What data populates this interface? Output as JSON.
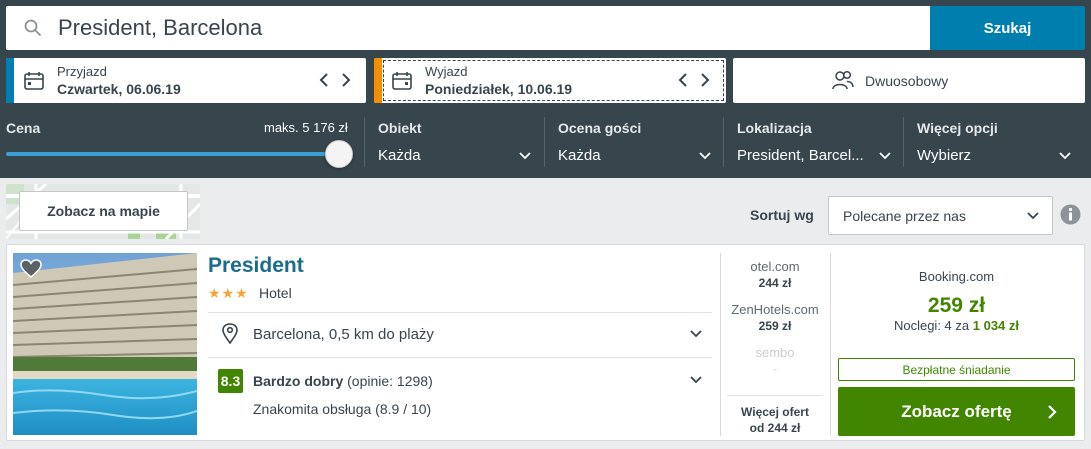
{
  "search": {
    "query": "President, Barcelona",
    "button_label": "Szukaj"
  },
  "dates": {
    "checkin_label": "Przyjazd",
    "checkin_value": "Czwartek, 06.06.19",
    "checkout_label": "Wyjazd",
    "checkout_value": "Poniedziałek, 10.06.19"
  },
  "room": {
    "label": "Dwuosobowy"
  },
  "filters": {
    "price_label": "Cena",
    "price_max": "maks. 5 176 zł",
    "price_slider_fraction": 1.0,
    "property_label": "Obiekt",
    "property_value": "Każda",
    "rating_label": "Ocena gości",
    "rating_value": "Każda",
    "location_label": "Lokalizacja",
    "location_value": "President, Barcel...",
    "more_label": "Więcej opcji",
    "more_value": "Wybierz"
  },
  "map": {
    "button_label": "Zobacz na mapie"
  },
  "sort": {
    "label": "Sortuj wg",
    "value": "Polecane przez nas"
  },
  "hotel": {
    "name": "President",
    "stars": "★★★",
    "type": "Hotel",
    "location": "Barcelona, 0,5 km do plaży",
    "rating_score": "8.3",
    "rating_word": "Bardzo dobry",
    "rating_reviews": "(opinie: 1298)",
    "rating_sub": "Znakomita obsługa (8.9 / 10)",
    "deals": [
      {
        "site": "otel.com",
        "price": "244 zł"
      },
      {
        "site": "ZenHotels.com",
        "price": "259 zł"
      },
      {
        "site": "sembo",
        "price": "-"
      }
    ],
    "more_offers_line1": "Więcej ofert",
    "more_offers_line2": "od 244 zł",
    "best_site": "Booking.com",
    "best_price": "259 zł",
    "nights_prefix": "Noclegi: 4 za",
    "nights_total": "1 034 zł",
    "breakfast": "Bezpłatne śniadanie",
    "offer_button": "Zobacz ofertę"
  },
  "colors": {
    "topbar": "#37454d",
    "primary_blue": "#007faf",
    "deal_green": "#428500",
    "checkin_accent": "#007faf",
    "checkout_accent": "#f48f00",
    "star": "#f4a639"
  }
}
